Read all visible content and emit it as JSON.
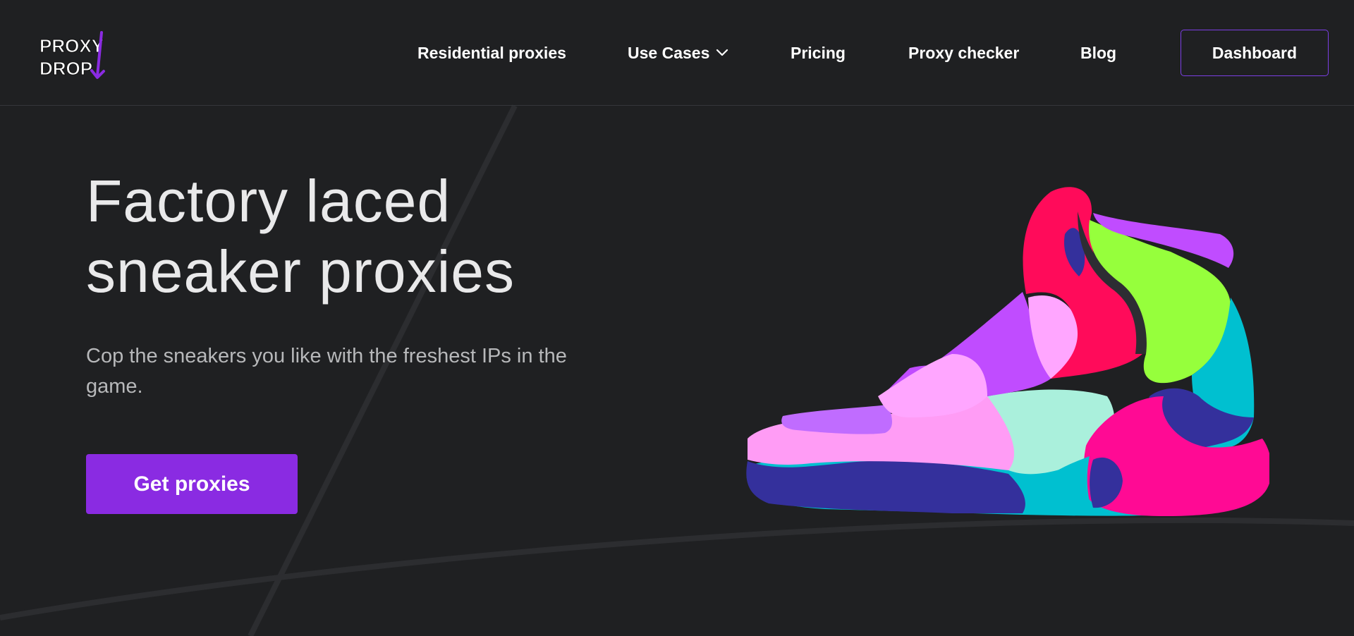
{
  "brand": {
    "logo_text_line1": "PROXY",
    "logo_text_line2": "DROP"
  },
  "nav": {
    "items": [
      {
        "label": "Residential proxies"
      },
      {
        "label": "Use Cases"
      },
      {
        "label": "Pricing"
      },
      {
        "label": "Proxy checker"
      },
      {
        "label": "Blog"
      }
    ],
    "dashboard_label": "Dashboard"
  },
  "hero": {
    "title_line1": "Factory laced",
    "title_line2": "sneaker proxies",
    "subtitle": "Cop the sneakers you like with the freshest IPs in the game.",
    "cta_label": "Get proxies"
  },
  "colors": {
    "background": "#1f2022",
    "accent": "#8a2be2",
    "dashboard_border": "#7b3fe4"
  },
  "icons": {
    "use_cases_chevron": "chevron-down-icon",
    "logo_arrow": "arrow-down-icon"
  }
}
